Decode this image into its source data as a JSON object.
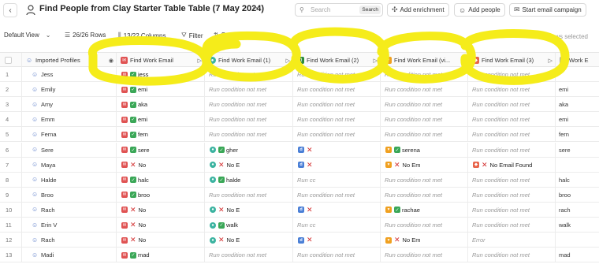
{
  "header": {
    "back": "‹",
    "title": "Find People from Clay Starter Table Table (7 May 2024)",
    "more": "···",
    "search_placeholder": "Search",
    "search_button": "Search",
    "add_enrichment": "Add enrichment",
    "add_people": "Add people",
    "start_campaign": "Start email campaign"
  },
  "toolbar": {
    "view": "Default View",
    "rows": "26/26 Rows",
    "columns": "13/22 Columns",
    "filter": "Filter",
    "sort": "Sort",
    "selected": "0/26 rows selected"
  },
  "columns": {
    "profiles": "Imported Profiles",
    "c1": "Find Work Email",
    "c2": "Find Work Email (1)",
    "c3": "Find Work Email (2)",
    "c4": "Find Work Email (vi...",
    "c5": "Find Work Email (3)",
    "c6": "Work E"
  },
  "rows": [
    {
      "n": "1",
      "name": "Jess",
      "c1": "jess",
      "c2": "Run condition not met",
      "c3": "Run condition not met",
      "c4": "Run condition not met",
      "c5": "Run condition not met",
      "c6": ""
    },
    {
      "n": "2",
      "name": "Emily",
      "c1": "emi",
      "c2": "Run condition not met",
      "c3": "Run condition not met",
      "c4": "Run condition not met",
      "c5": "Run condition not met",
      "c6": "emi"
    },
    {
      "n": "3",
      "name": "Amy",
      "c1": "aka",
      "c2": "Run condition not met",
      "c3": "Run condition not met",
      "c4": "Run condition not met",
      "c5": "Run condition not met",
      "c6": "aka"
    },
    {
      "n": "4",
      "name": "Emm",
      "c1": "emi",
      "c2": "Run condition not met",
      "c3": "Run condition not met",
      "c4": "Run condition not met",
      "c5": "Run condition not met",
      "c6": "emi"
    },
    {
      "n": "5",
      "name": "Ferna",
      "c1": "fern",
      "c2": "Run condition not met",
      "c3": "Run condition not met",
      "c4": "Run condition not met",
      "c5": "Run condition not met",
      "c6": "fern"
    },
    {
      "n": "6",
      "name": "Sere",
      "c1": "sere",
      "c2": "gher",
      "c3": "",
      "c4": "serena",
      "c5": "Run condition not met",
      "c6": "sere"
    },
    {
      "n": "7",
      "name": "Maya",
      "c1": "No",
      "c2": "No E",
      "c3": "",
      "c4": "No Em",
      "c5": "No Email Found",
      "c6": ""
    },
    {
      "n": "8",
      "name": "Halde",
      "c1": "halc",
      "c2": "halde",
      "c3": "Run cc",
      "c4": "Run condition not met",
      "c5": "Run condition not met",
      "c6": "halc"
    },
    {
      "n": "9",
      "name": "Broo",
      "c1": "broo",
      "c2": "Run condition not met",
      "c3": "Run condition not met",
      "c4": "Run condition not met",
      "c5": "Run condition not met",
      "c6": "broo"
    },
    {
      "n": "10",
      "name": "Rach",
      "c1": "No",
      "c2": "No E",
      "c3": "",
      "c4": "rachae",
      "c5": "Run condition not met",
      "c6": "rach"
    },
    {
      "n": "11",
      "name": "Erin V",
      "c1": "No",
      "c2": "walk",
      "c3": "Run cc",
      "c4": "Run condition not met",
      "c5": "Run condition not met",
      "c6": "walk"
    },
    {
      "n": "12",
      "name": "Rach",
      "c1": "No",
      "c2": "No E",
      "c3": "",
      "c4": "No Em",
      "c5": "Error",
      "c6": ""
    },
    {
      "n": "13",
      "name": "Madi",
      "c1": "mad",
      "c2": "Run condition not met",
      "c3": "Run condition not met",
      "c4": "Run condition not met",
      "c5": "Run condition not met",
      "c6": "mad"
    }
  ],
  "colors": {
    "highlight": "#f5ec1a",
    "found": "#3aa757",
    "not_found": "#d32f2f",
    "provider_red": "#e05353",
    "provider_teal": "#3bb3a0",
    "provider_green": "#2e8b3d",
    "provider_orange": "#f0a020",
    "provider_salmon": "#e8644a"
  }
}
